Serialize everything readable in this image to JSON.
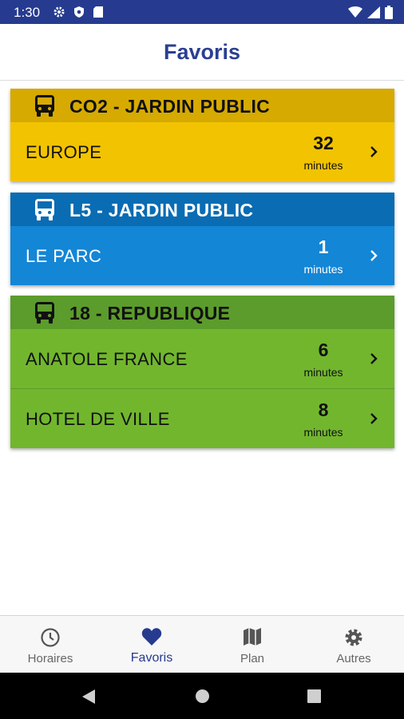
{
  "status_bar": {
    "time": "1:30"
  },
  "header": {
    "title": "Favoris"
  },
  "colors": {
    "accent": "#263b8f",
    "yellow_head": "#d6aa00",
    "yellow_body": "#f2c300",
    "blue_head": "#0a6cb3",
    "blue_body": "#1386d6",
    "green_head": "#5b9c2c",
    "green_body": "#72b62e"
  },
  "cards": [
    {
      "line": "CO2 - JARDIN PUBLIC",
      "icon": "bus-icon",
      "rows": [
        {
          "stop": "EUROPE",
          "wait": "32",
          "unit": "minutes"
        }
      ]
    },
    {
      "line": "L5 - JARDIN PUBLIC",
      "icon": "bus-icon",
      "rows": [
        {
          "stop": "LE PARC",
          "wait": "1",
          "unit": "minutes"
        }
      ]
    },
    {
      "line": "18 - REPUBLIQUE",
      "icon": "bus-icon",
      "rows": [
        {
          "stop": "ANATOLE FRANCE",
          "wait": "6",
          "unit": "minutes"
        },
        {
          "stop": "HOTEL DE VILLE",
          "wait": "8",
          "unit": "minutes"
        }
      ]
    }
  ],
  "bottom_nav": [
    {
      "label": "Horaires",
      "icon": "clock-icon"
    },
    {
      "label": "Favoris",
      "icon": "heart-icon",
      "active": true
    },
    {
      "label": "Plan",
      "icon": "map-icon"
    },
    {
      "label": "Autres",
      "icon": "gear-icon"
    }
  ]
}
